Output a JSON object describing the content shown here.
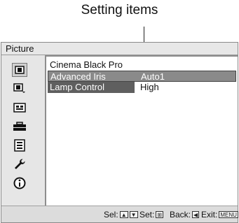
{
  "callout": {
    "label": "Setting items"
  },
  "menu": {
    "title": "Picture",
    "sidebar_icons": [
      "picture-icon",
      "advanced-picture-icon",
      "screen-icon",
      "setup-toolbox-icon",
      "function-list-icon",
      "installation-wrench-icon",
      "information-icon"
    ],
    "items": [
      {
        "label": "Cinema Black Pro",
        "value": ""
      },
      {
        "label": "Advanced Iris",
        "value": "Auto1"
      },
      {
        "label": "Lamp Control",
        "value": "High"
      }
    ],
    "footer": {
      "sel_label": "Sel:",
      "set_label": "Set:",
      "back_label": "Back:",
      "exit_label": "Exit:",
      "menu_key": "MENU"
    }
  }
}
